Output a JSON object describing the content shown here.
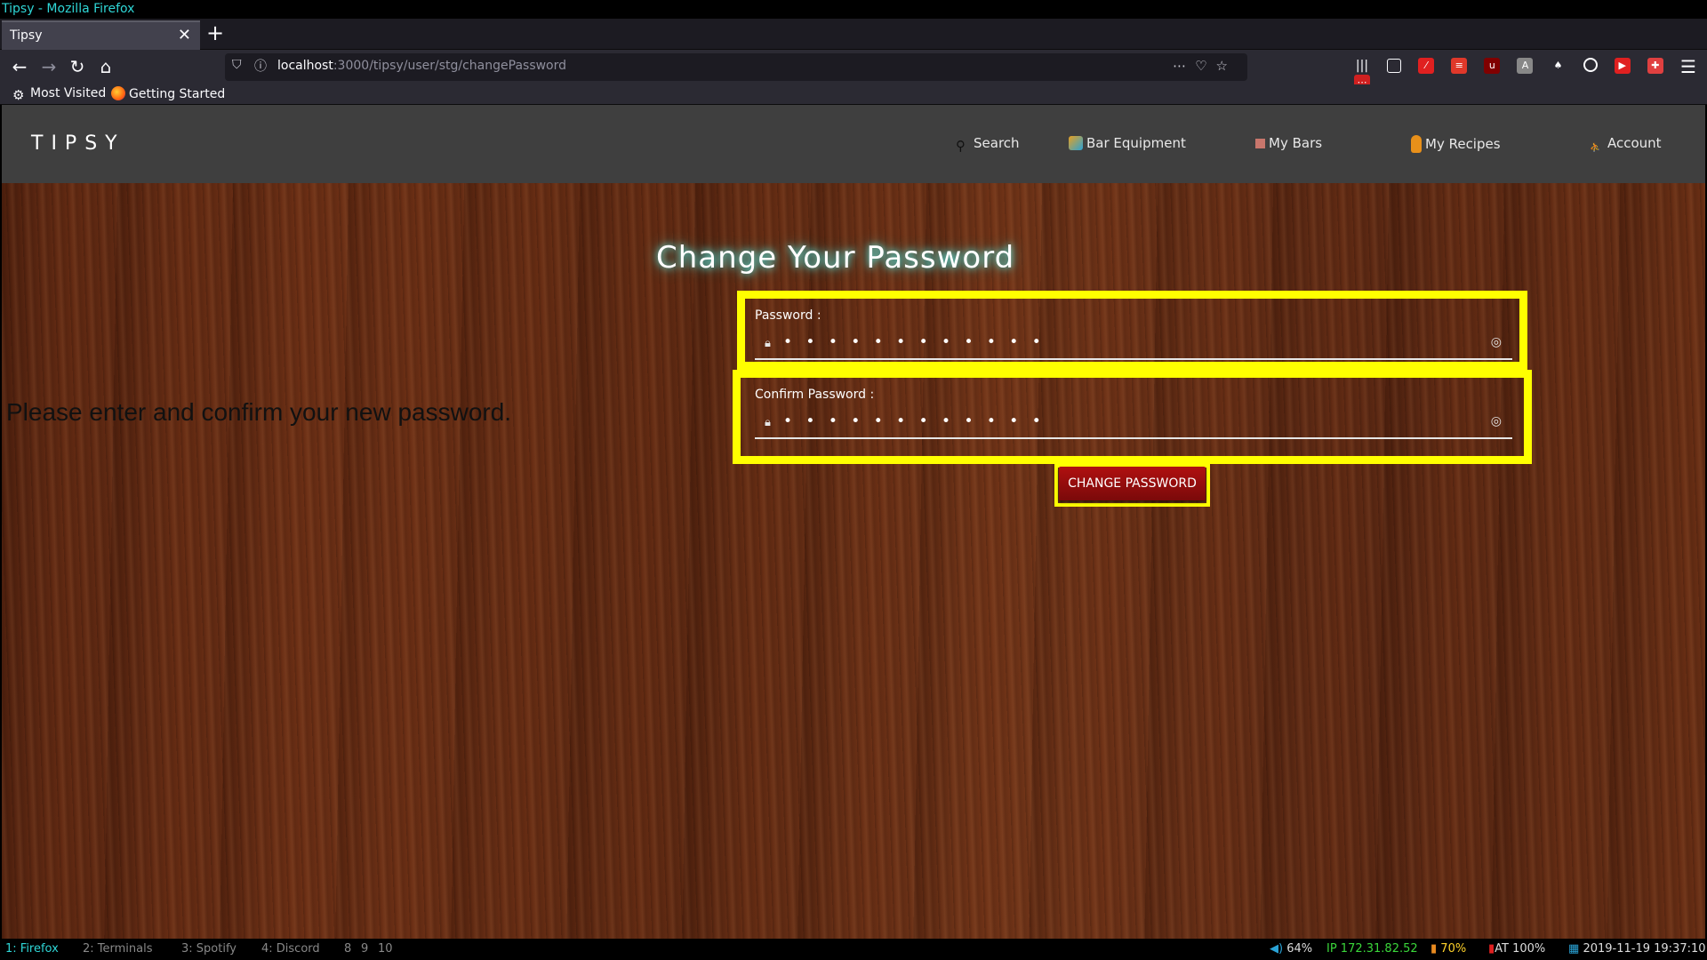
{
  "window": {
    "title": "Tipsy - Mozilla Firefox"
  },
  "browser": {
    "tab_title": "Tipsy",
    "url_host": "localhost",
    "url_path": ":3000/tipsy/user/stg/changePassword",
    "bookmarks": [
      "Most Visited",
      "Getting Started"
    ]
  },
  "site": {
    "brand": "TIPSY",
    "nav": {
      "search": "Search",
      "bar_equipment": "Bar Equipment",
      "my_bars": "My Bars",
      "my_recipes": "My Recipes",
      "account": "Account"
    }
  },
  "page": {
    "heading": "Change Your Password",
    "instruction": "Please enter and confirm your new password.",
    "password_label": "Password :",
    "password_value": "• • • • • • • • • • • •",
    "confirm_label": "Confirm Password :",
    "confirm_value": "• • • • • • • • • • • •",
    "submit_label": "CHANGE PASSWORD"
  },
  "taskbar": {
    "workspaces": [
      "1: Firefox",
      "2: Terminals",
      "3: Spotify",
      "4: Discord",
      "8",
      "9",
      "10"
    ],
    "volume": "64%",
    "ip": "IP 172.31.82.52",
    "wifi": "70%",
    "battery": "AT 100%",
    "datetime": "2019-11-19 19:37:10"
  },
  "colors": {
    "highlight": "#ffff00",
    "button": "#9c0e0e",
    "glow": "#5ee8e0"
  }
}
